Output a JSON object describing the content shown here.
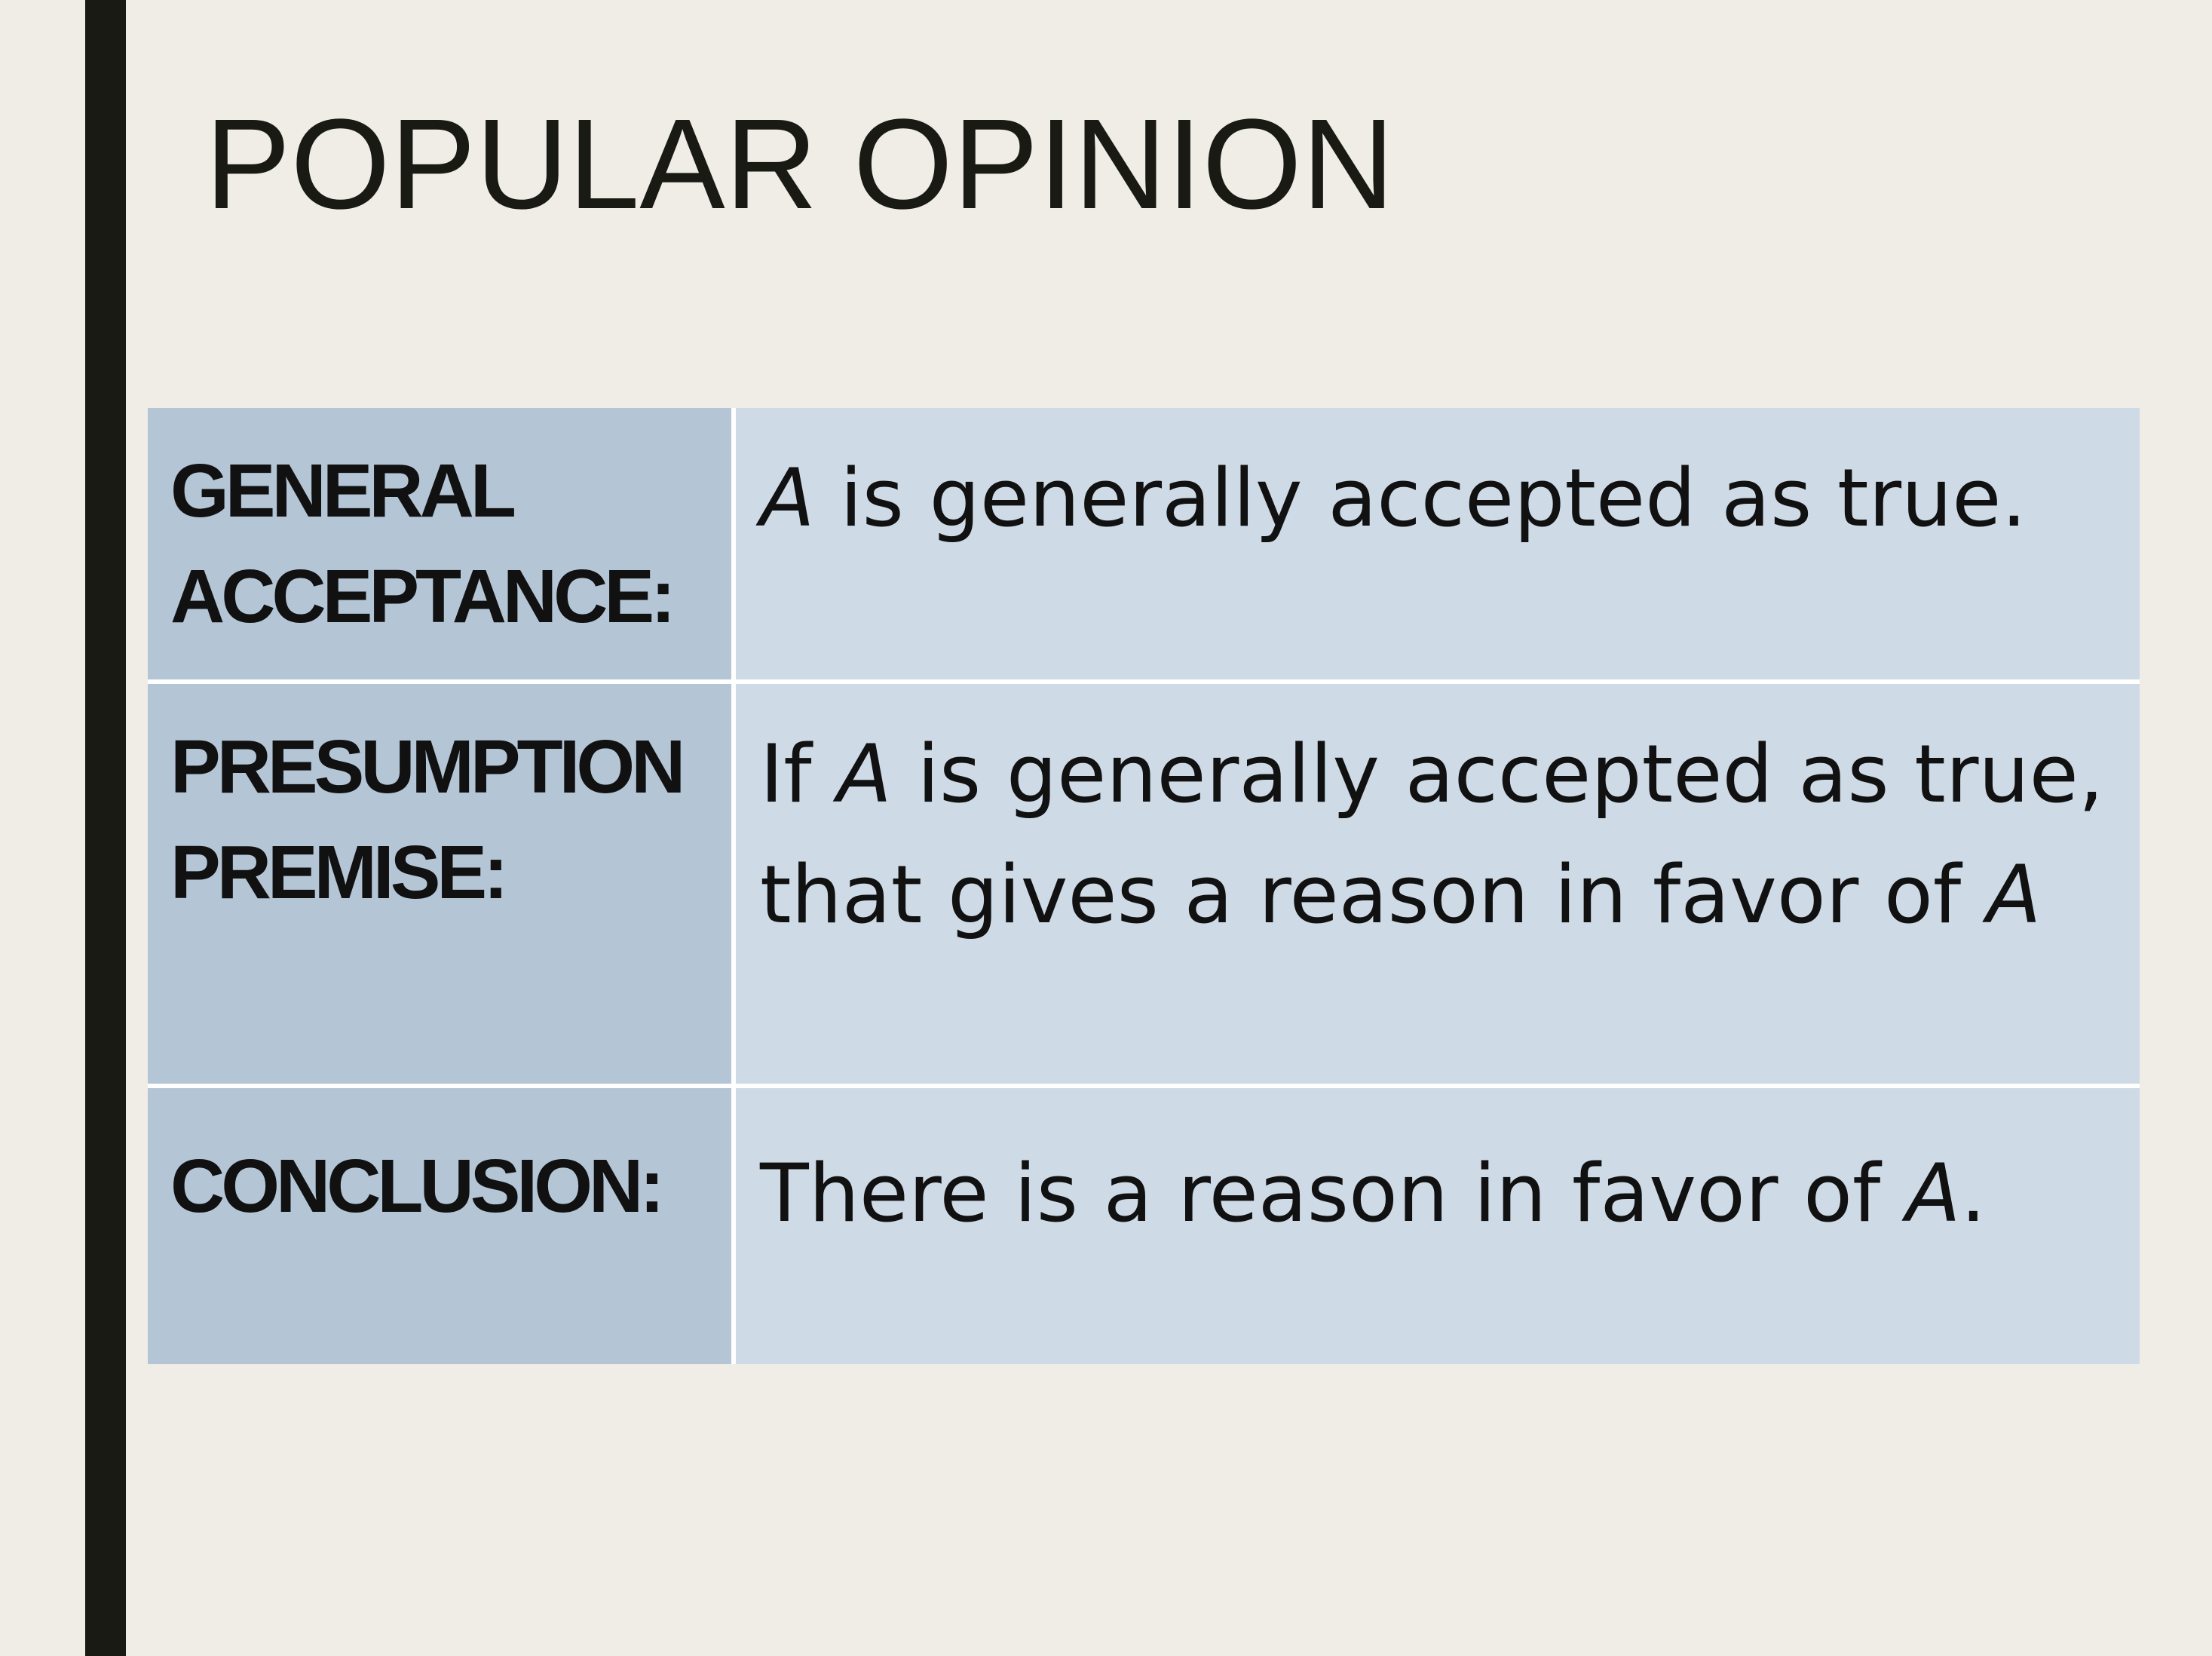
{
  "slide": {
    "title": "POPULAR OPINION"
  },
  "table": {
    "rows": [
      {
        "label": "GENERAL ACCEPTANCE:",
        "text_parts": [
          {
            "text": "A",
            "italic": true
          },
          {
            "text": " is generally accepted as true.",
            "italic": false
          }
        ]
      },
      {
        "label": "PRESUMPTION PREMISE:",
        "text_parts": [
          {
            "text": "If ",
            "italic": false
          },
          {
            "text": "A",
            "italic": true
          },
          {
            "text": " is generally accepted as true, that gives a reason in favor of ",
            "italic": false
          },
          {
            "text": "A",
            "italic": true
          }
        ]
      },
      {
        "label": "CONCLUSION:",
        "text_parts": [
          {
            "text": "There is a reason in favor of ",
            "italic": false
          },
          {
            "text": "A",
            "italic": true
          },
          {
            "text": ".",
            "italic": false
          }
        ]
      }
    ]
  },
  "colors": {
    "background": "#f0ede6",
    "side_bar": "#1a1a14",
    "label_cell": "#b4c5d6",
    "text_cell": "#cedae6"
  }
}
